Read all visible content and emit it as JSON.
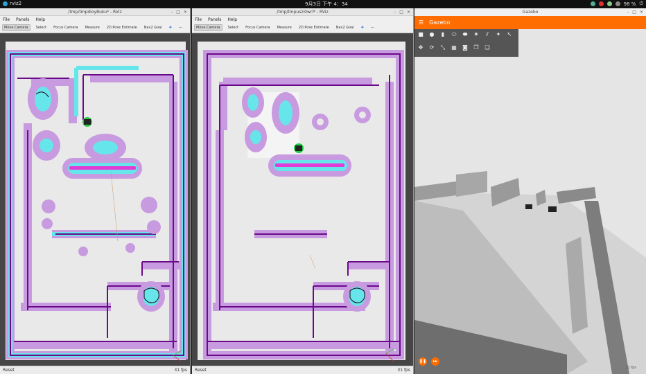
{
  "topbar": {
    "app_name": "rviz2",
    "clock": "9月3日 下午 4：34",
    "battery": "98 %"
  },
  "rviz_left": {
    "title": "/tmp/tmpdioyBuku* - RViz",
    "menu": [
      "File",
      "Panels",
      "Help"
    ],
    "tools": [
      "Move Camera",
      "Select",
      "Focus Camera",
      "Measure",
      "2D Pose Estimate",
      "Nav2 Goal"
    ],
    "reset": "Reset",
    "fps": "31 fps"
  },
  "rviz_right": {
    "title": "/tmp/tmpuszi0wrl* - RViz",
    "menu": [
      "File",
      "Panels",
      "Help"
    ],
    "tools": [
      "Move Camera",
      "Select",
      "Focus Camera",
      "Measure",
      "2D Pose Estimate",
      "Nav2 Goal"
    ],
    "reset": "Reset",
    "fps": "31 fps"
  },
  "gazebo": {
    "window_title": "Gazebo",
    "header_title": "Gazebo",
    "toolbar_icons": [
      "box-icon",
      "sphere-icon",
      "cylinder-icon",
      "capsule-icon",
      "ellipsoid-icon",
      "sun-icon",
      "directional-light-icon",
      "spot-light-icon",
      "select-icon",
      "translate-icon",
      "rotate-icon",
      "scale-icon",
      "grid-icon",
      "screenshot-icon",
      "copy-icon",
      "paste-icon"
    ],
    "fps": "31 fps"
  },
  "colors": {
    "costmap_outer": "#c89adf",
    "costmap_mid": "#66e6ea",
    "costmap_inner": "#e23bd6",
    "wall": "#6a0a8a",
    "floor": "#e9e9e9",
    "gazebo_accent": "#ff6d00"
  }
}
